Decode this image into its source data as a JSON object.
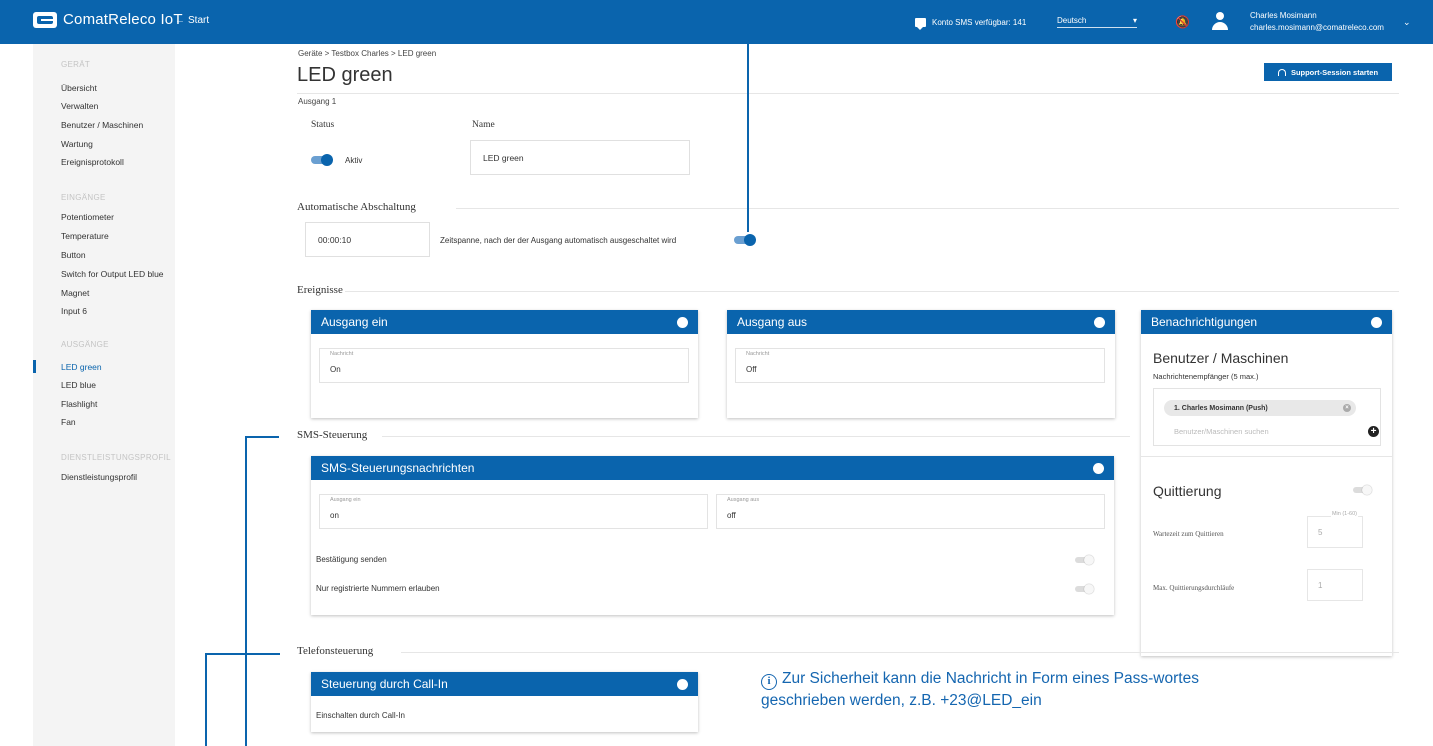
{
  "app": {
    "name": "ComatReleco IoT",
    "back_label": "Start",
    "sms_credits": "Konto SMS verfügbar: 141",
    "language": "Deutsch",
    "user_name": "Charles Mosimann",
    "user_email": "charles.mosimann@comatreleco.com"
  },
  "sidebar": {
    "sections": {
      "geraet": "GERÄT",
      "eingaenge": "EINGÄNGE",
      "ausgaenge": "AUSGÄNGE",
      "dienst": "DIENSTLEISTUNGSPROFIL"
    },
    "items": [
      "Übersicht",
      "Verwalten",
      "Benutzer / Maschinen",
      "Wartung",
      "Ereignisprotokoll",
      "Potentiometer",
      "Temperature",
      "Button",
      "Switch for Output LED blue",
      "Magnet",
      "Input 6",
      "LED green",
      "LED blue",
      "Flashlight",
      "Fan",
      "Dienstleistungsprofil"
    ]
  },
  "header": {
    "breadcrumb": "Geräte > Testbox Charles > LED green",
    "title": "LED green",
    "subtitle": "Ausgang 1",
    "support_button": "Support-Session starten"
  },
  "general": {
    "status_label": "Status",
    "status_value": "Aktiv",
    "name_label": "Name",
    "name_value": "LED green"
  },
  "auto_off": {
    "title": "Automatische Abschaltung",
    "duration": "00:00:10",
    "description": "Zeitspanne, nach der der Ausgang automatisch ausgeschaltet wird"
  },
  "events": {
    "title": "Ereignisse",
    "on_card": {
      "title": "Ausgang ein",
      "field_label": "Nachricht",
      "value": "On"
    },
    "off_card": {
      "title": "Ausgang aus",
      "field_label": "Nachricht",
      "value": "Off"
    }
  },
  "notifications": {
    "title": "Benachrichtigungen",
    "heading": "Benutzer / Maschinen",
    "recipients_label": "Nachrichtenempfänger (5 max.)",
    "recipient": "1. Charles Mosimann (Push)",
    "search_placeholder": "Benutzer/Maschinen suchen",
    "ack_title": "Quittierung",
    "wait_label": "Wartezeit zum Quittieren",
    "wait_hint": "Min (1-60)",
    "wait_value": "5",
    "max_label": "Max. Quittierungsdurchläufe",
    "max_value": "1"
  },
  "sms": {
    "section_title": "SMS-Steuerung",
    "card_title": "SMS-Steuerungsnachrichten",
    "on_label": "Ausgang ein",
    "on_value": "on",
    "off_label": "Ausgang aus",
    "off_value": "off",
    "confirm_label": "Bestätigung senden",
    "registered_label": "Nur registrierte Nummern erlauben"
  },
  "phone": {
    "section_title": "Telefonsteuerung",
    "card_title": "Steuerung durch Call-In",
    "row_label": "Einschalten durch Call-In"
  },
  "info_note": "Zur Sicherheit kann die Nachricht in Form eines Pass-wortes geschrieben werden, z.B. +23@LED_ein",
  "colors": {
    "primary": "#0a64ad",
    "annotation": "#1566b0"
  }
}
